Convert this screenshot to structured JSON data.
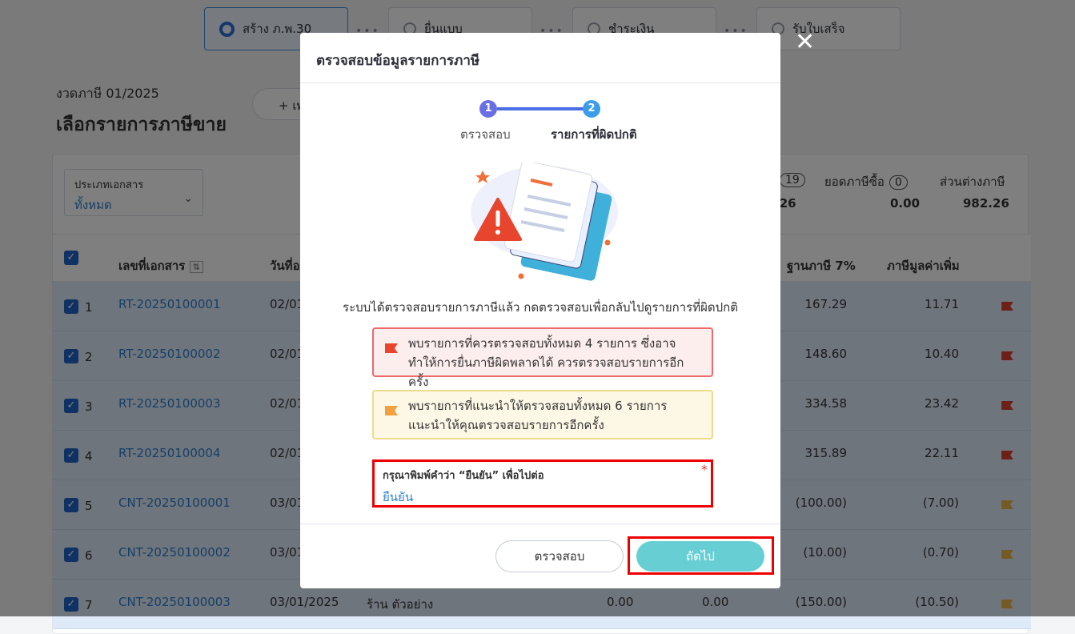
{
  "steps": [
    {
      "label": "สร้าง ภ.พ.30",
      "active": true
    },
    {
      "label": "ยื่นแบบ"
    },
    {
      "label": "ชำระเงิน"
    },
    {
      "label": "รับใบเสร็จ"
    }
  ],
  "period": "งวดภาษี 01/2025",
  "page_title": "เลือกรายการภาษีขาย",
  "add_button": "+ เพ",
  "filter": {
    "label": "ประเภทเอกสาร",
    "value": "ทั้งหมด"
  },
  "summary": {
    "sales_count": "19",
    "sales_value": ".26",
    "purchase_label": "ยอดภาษีซื้อ",
    "purchase_count": "0",
    "purchase_value": "0.00",
    "diff_label": "ส่วนต่างภาษี",
    "diff_value": "982.26"
  },
  "table": {
    "headers": {
      "doc_no": "เลขที่เอกสาร",
      "date": "วันที่อ",
      "base": "ฐานภาษี 7%",
      "vat": "ภาษีมูลค่าเพิ่ม"
    },
    "rows": [
      {
        "n": "1",
        "doc": "RT-20250100001",
        "date": "02/01",
        "base": "167.29",
        "vat": "11.71",
        "flag": "red"
      },
      {
        "n": "2",
        "doc": "RT-20250100002",
        "date": "02/01",
        "base": "148.60",
        "vat": "10.40",
        "flag": "red"
      },
      {
        "n": "3",
        "doc": "RT-20250100003",
        "date": "02/01",
        "base": "334.58",
        "vat": "23.42",
        "flag": "red"
      },
      {
        "n": "4",
        "doc": "RT-20250100004",
        "date": "02/01",
        "base": "315.89",
        "vat": "22.11",
        "flag": "red"
      },
      {
        "n": "5",
        "doc": "CNT-20250100001",
        "date": "03/01",
        "base": "(100.00)",
        "vat": "(7.00)",
        "flag": "yellow"
      },
      {
        "n": "6",
        "doc": "CNT-20250100002",
        "date": "03/01",
        "base": "(10.00)",
        "vat": "(0.70)",
        "flag": "yellow"
      },
      {
        "n": "7",
        "doc": "CNT-20250100003",
        "date": "03/01/2025",
        "shop": "ร้าน ตัวอย่าง",
        "c1": "0.00",
        "c2": "0.00",
        "base": "(150.00)",
        "vat": "(10.50)",
        "flag": "yellow"
      }
    ]
  },
  "modal": {
    "title": "ตรวจสอบข้อมูลรายการภาษี",
    "step1_num": "1",
    "step1_label": "ตรวจสอบ",
    "step2_num": "2",
    "step2_label": "รายการที่ผิดปกติ",
    "message": "ระบบได้ตรวจสอบรายการภาษีแล้ว กดตรวจสอบเพื่อกลับไปดูรายการที่ผิดปกติ",
    "alert_red": "พบรายการที่ควรตรวจสอบทั้งหมด 4 รายการ ซึ่งอาจทำให้การยื่นภาษีผิดพลาดได้ ควรตรวจสอบรายการอีกครั้ง",
    "alert_yellow": "พบรายการที่แนะนำให้ตรวจสอบทั้งหมด 6 รายการ แนะนำให้คุณตรวจสอบรายการอีกครั้ง",
    "confirm_label": "กรุณาพิมพ์คำว่า “ยืนยัน” เพื่อไปต่อ",
    "confirm_value": "ยืนยัน",
    "required_mark": "*",
    "btn_check": "ตรวจสอบ",
    "btn_next": "ถัดไป",
    "close": "✕"
  },
  "colors": {
    "primary": "#2b6fd6",
    "next_button": "#67cfd4",
    "flag_red": "#d9412e",
    "flag_yellow": "#e8b64a"
  }
}
